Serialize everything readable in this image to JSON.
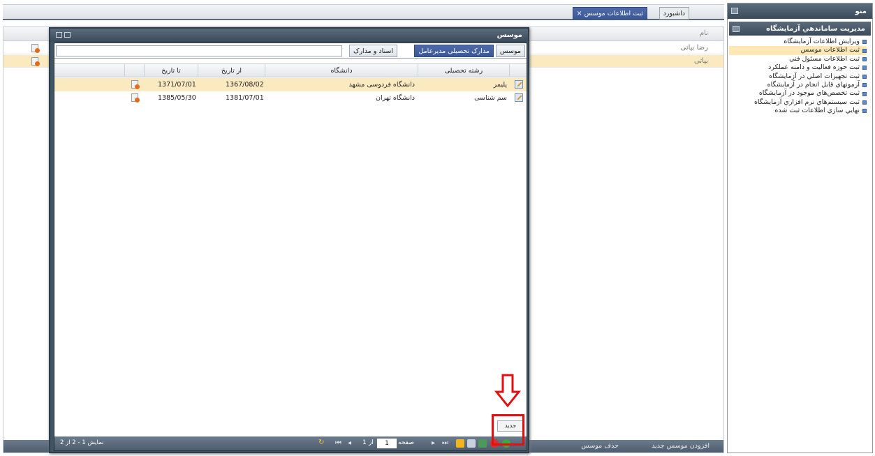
{
  "menu": {
    "header": "منو",
    "section_title": "مديريت ساماندهي آزمايشگاه",
    "items": [
      {
        "label": "ويرايش اطلاعات آزمايشگاه",
        "selected": false
      },
      {
        "label": "ثبت اطلاعات موسس",
        "selected": true
      },
      {
        "label": "ثبت اطلاعات مسئول فني",
        "selected": false
      },
      {
        "label": "ثبت حوزه فعاليت و دامنه عملكرد",
        "selected": false
      },
      {
        "label": "ثبت تجهيزات اصلي در آزمايشگاه",
        "selected": false
      },
      {
        "label": "آزمونهاي قابل انجام در آزمايشگاه",
        "selected": false
      },
      {
        "label": "ثبت تخصص‌هاي موجود در آزمايشگاه",
        "selected": false
      },
      {
        "label": "ثبت سيستم‌هاي نرم افزاري آزمايشگاه",
        "selected": false
      },
      {
        "label": "نهايي سازي اطلاعات ثبت شده",
        "selected": false
      }
    ]
  },
  "tabs": {
    "dashboard": "داشبورد",
    "active": "ثبت اطلاعات موسس",
    "close": "×"
  },
  "main_grid": {
    "column_name": "نام",
    "rows": [
      "رضا بیاتی",
      "بیاتی"
    ]
  },
  "main_toolbar": {
    "add": "افزودن موسس جدید",
    "delete": "حذف موسس"
  },
  "dialog": {
    "title": "موسس",
    "tabs": [
      "موسس",
      "مدارک تحصیلی مدیرعامل",
      "اسناد و مدارک"
    ],
    "active_tab": 1,
    "columns": {
      "field": "رشته تحصیلی",
      "university": "دانشگاه",
      "from": "از تاریخ",
      "to": "تا تاریخ"
    },
    "rows": [
      {
        "field": "پلیمر",
        "university": "دانشگاه فردوسی مشهد",
        "from": "1367/08/02",
        "to": "1371/07/01",
        "selected": true
      },
      {
        "field": "سم شناسی",
        "university": "دانشگاه تهران",
        "from": "1381/07/01",
        "to": "1385/05/30",
        "selected": false
      }
    ],
    "new_tooltip": "جدید",
    "pager": {
      "page_label": "صفحه",
      "page": "1",
      "of_label": "از",
      "of_value": "1",
      "summary": "نمایش 1 - 2 از 2"
    }
  },
  "colors": {
    "header_dark": "#415464",
    "accent_blue": "#3b5896",
    "selected_row": "#fbe9c0",
    "highlight_red": "#e01010"
  }
}
